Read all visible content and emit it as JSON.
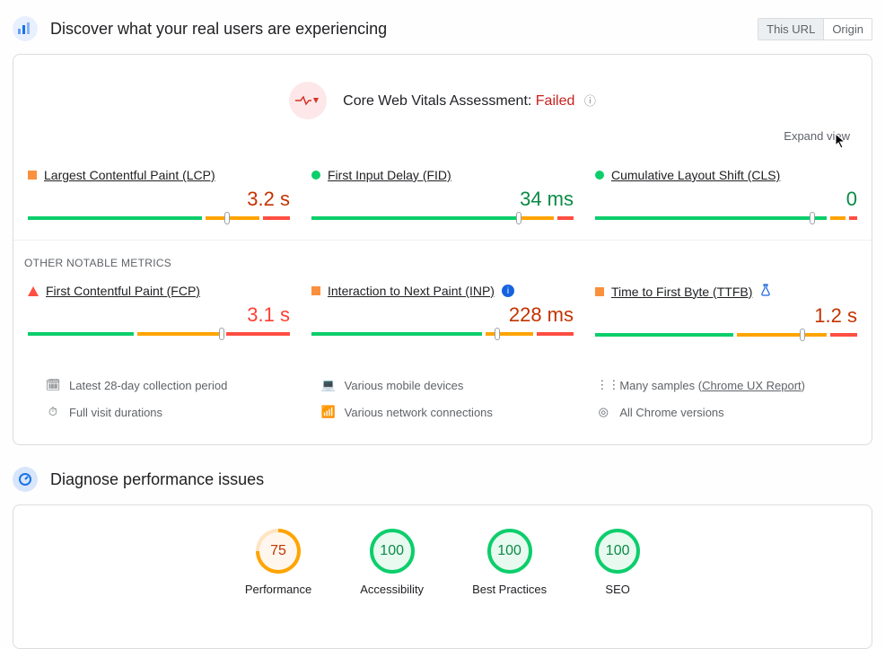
{
  "header": {
    "discover_title": "Discover what your real users are experiencing",
    "tabs": {
      "this_url": "This URL",
      "origin": "Origin"
    }
  },
  "cwv": {
    "title_prefix": "Core Web Vitals Assessment: ",
    "status": "Failed",
    "expand": "Expand view",
    "metrics": {
      "lcp": {
        "name": "Largest Contentful Paint (LCP)",
        "value": "3.2 s"
      },
      "fid": {
        "name": "First Input Delay (FID)",
        "value": "34 ms"
      },
      "cls": {
        "name": "Cumulative Layout Shift (CLS)",
        "value": "0"
      }
    }
  },
  "other": {
    "label": "OTHER NOTABLE METRICS",
    "fcp": {
      "name": "First Contentful Paint (FCP)",
      "value": "3.1 s"
    },
    "inp": {
      "name": "Interaction to Next Paint (INP)",
      "value": "228 ms"
    },
    "ttfb": {
      "name": "Time to First Byte (TTFB)",
      "value": "1.2 s"
    }
  },
  "meta": {
    "period": "Latest 28-day collection period",
    "durations": "Full visit durations",
    "devices": "Various mobile devices",
    "network": "Various network connections",
    "samples_prefix": "Many samples (",
    "samples_link": "Chrome UX Report",
    "samples_suffix": ")",
    "chrome": "All Chrome versions"
  },
  "diagnose": {
    "title": "Diagnose performance issues"
  },
  "scores": {
    "performance": {
      "label": "Performance",
      "value": "75"
    },
    "accessibility": {
      "label": "Accessibility",
      "value": "100"
    },
    "best_practices": {
      "label": "Best Practices",
      "value": "100"
    },
    "seo": {
      "label": "SEO",
      "value": "100"
    }
  }
}
